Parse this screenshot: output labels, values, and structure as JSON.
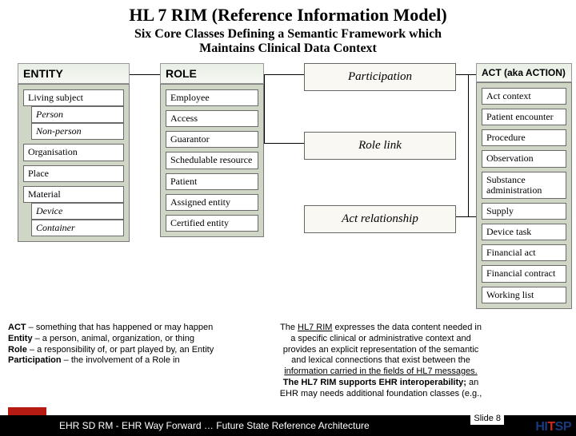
{
  "title": "HL 7 RIM (Reference Information Model)",
  "subtitle_l1": "Six Core Classes Defining a Semantic Framework which",
  "subtitle_l2": "Maintains Clinical Data Context",
  "columns": {
    "entity": {
      "header": "ENTITY",
      "items": [
        "Living subject",
        "Person",
        "Non-person",
        "Organisation",
        "Place",
        "Material",
        "Device",
        "Container"
      ]
    },
    "role": {
      "header": "ROLE",
      "items": [
        "Employee",
        "Access",
        "Guarantor",
        "Schedulable resource",
        "Patient",
        "Assigned entity",
        "Certified entity"
      ]
    },
    "act": {
      "header": "ACT (aka ACTION)",
      "items": [
        "Act context",
        "Patient encounter",
        "Procedure",
        "Observation",
        "Substance administration",
        "Supply",
        "Device task",
        "Financial act",
        "Financial contract",
        "Working list"
      ]
    }
  },
  "mid": {
    "participation": "Participation",
    "rolelink": "Role link",
    "actrel": "Act  relationship"
  },
  "defs": {
    "act_b": "ACT",
    "act_t": " – something that has happened or may happen",
    "ent_b": "Entity",
    "ent_t": " – a person, animal, organization, or thing",
    "rol_b": "Role",
    "rol_t": " – a responsibility of, or part played by, an Entity",
    "par_b": "Participation",
    "par_t": " – the involvement of a Role in"
  },
  "expl": {
    "l1a": "The ",
    "l1u": "HL7 RIM",
    "l1b": " expresses the data content needed in a specific clinical or administrative context and provides an explicit representation of the semantic and lexical connections that exist between the ",
    "l1u2": "information carried in the fields of HL7 messages.",
    "l2b": "The HL7 RIM supports EHR interoperability;",
    "l2t": " an EHR may needs additional foundation classes (e.g.,"
  },
  "footer": {
    "text": "EHR SD RM - EHR Way Forward … Future State Reference Architecture",
    "slide": "Slide 8"
  },
  "brand": {
    "h": "HI",
    "t": "T",
    "sp": "SP"
  }
}
